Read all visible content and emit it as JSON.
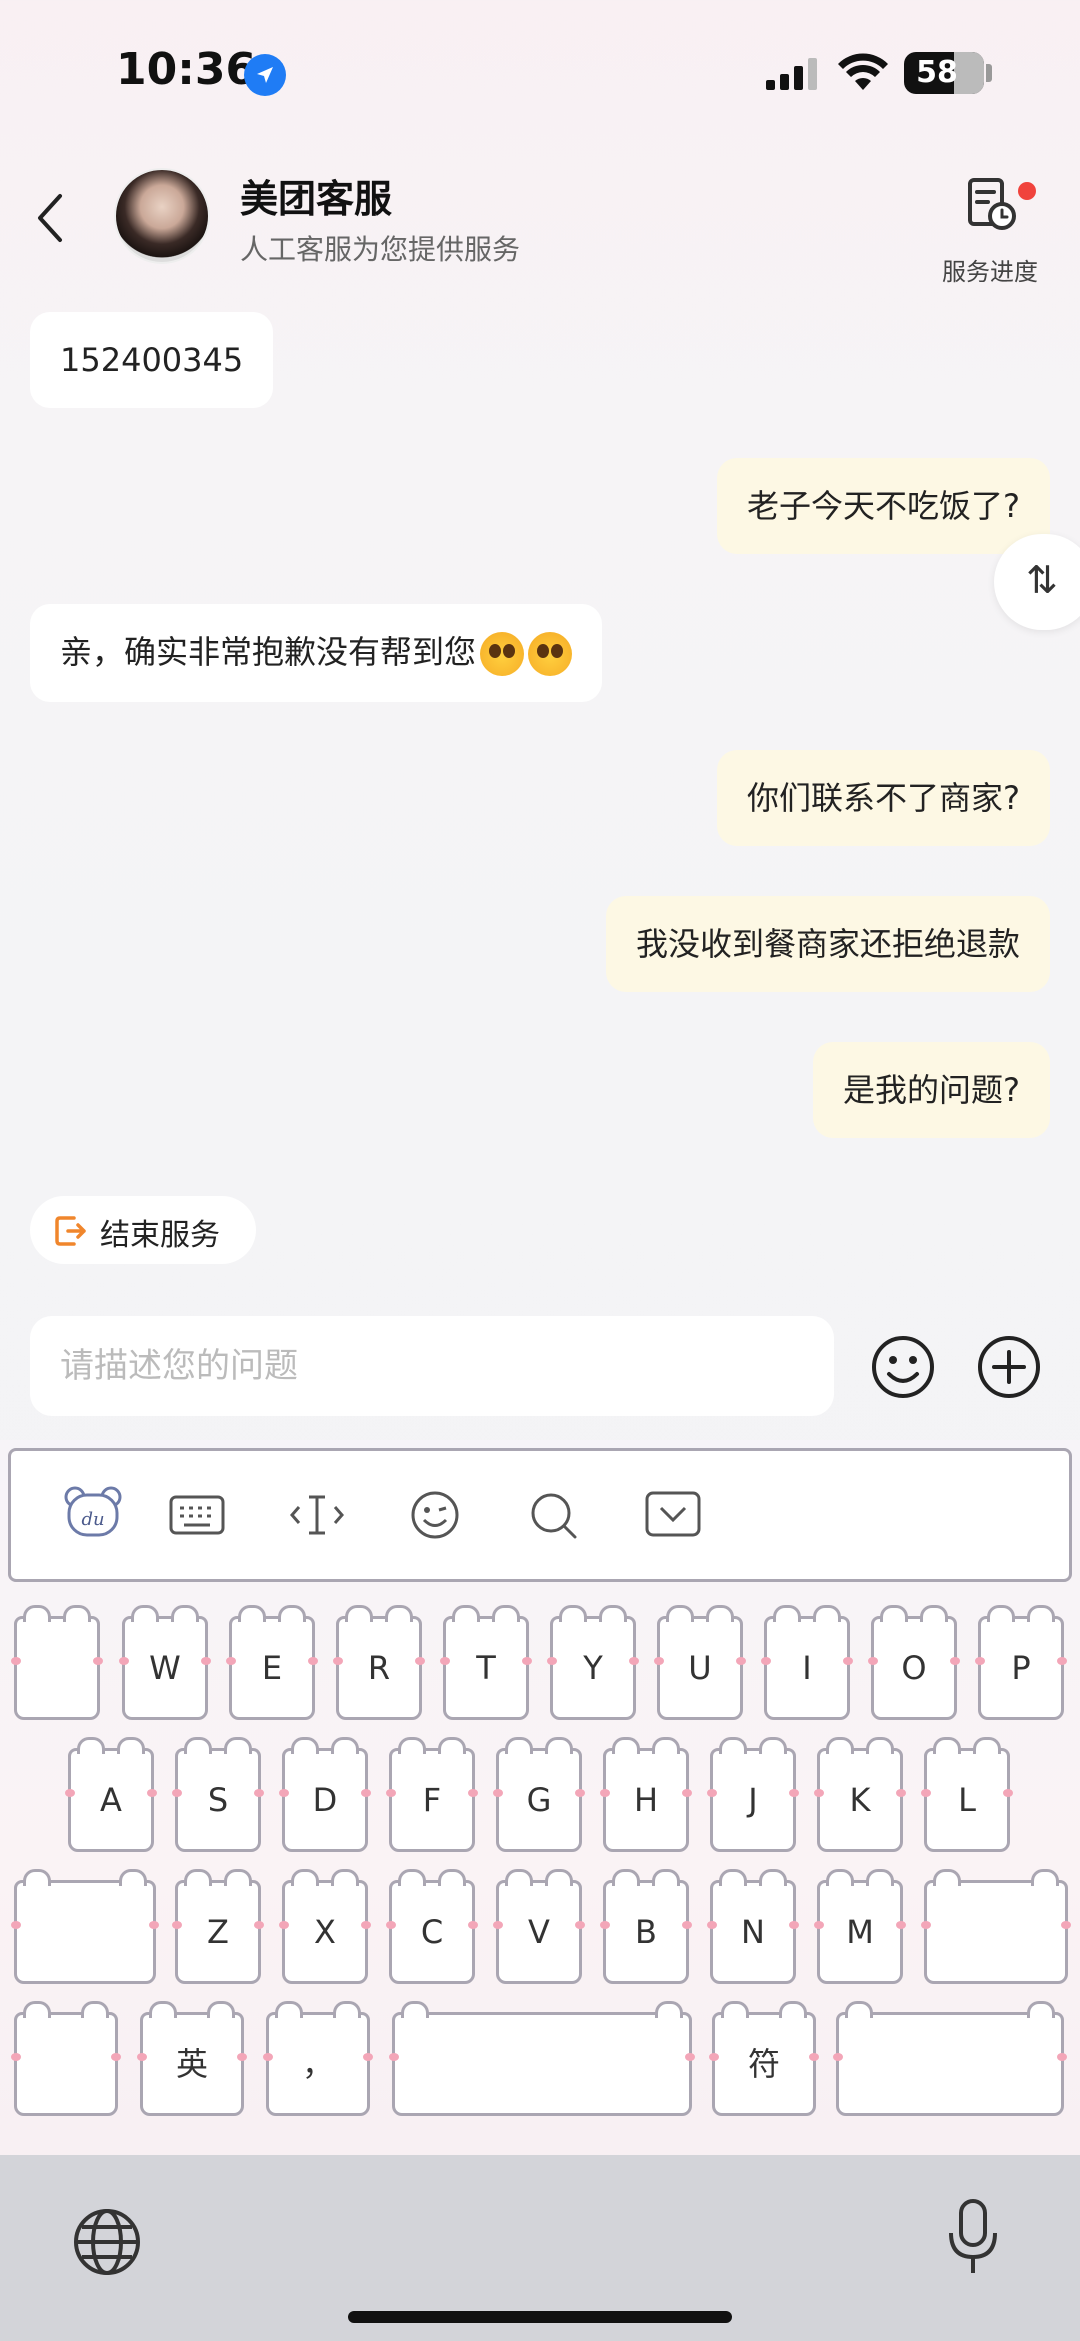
{
  "status_bar": {
    "time": "10:36",
    "battery": "58"
  },
  "header": {
    "title": "美团客服",
    "subtitle": "人工客服为您提供服务",
    "progress_label": "服务进度"
  },
  "messages": [
    {
      "side": "left",
      "text": "152400345"
    },
    {
      "side": "right",
      "text": "老子今天不吃饭了?"
    },
    {
      "side": "left",
      "text": "亲，确实非常抱歉没有帮到您"
    },
    {
      "side": "right",
      "text": "你们联系不了商家?"
    },
    {
      "side": "right",
      "text": "我没收到餐商家还拒绝退款"
    },
    {
      "side": "right",
      "text": "是我的问题?"
    }
  ],
  "sort_button": {
    "label": "⇅"
  },
  "end_service": {
    "label": "结束服务"
  },
  "input": {
    "placeholder": "请描述您的问题",
    "value": ""
  },
  "keyboard": {
    "row1": [
      "",
      "W",
      "E",
      "R",
      "T",
      "Y",
      "U",
      "I",
      "O",
      "P"
    ],
    "row2": [
      "A",
      "S",
      "D",
      "F",
      "G",
      "H",
      "J",
      "K",
      "L"
    ],
    "row3": [
      "Z",
      "X",
      "C",
      "V",
      "B",
      "N",
      "M"
    ],
    "lang_key": "英",
    "comma_key": "，",
    "symbol_key": "符"
  },
  "colors": {
    "accent_orange": "#f0862c",
    "badge_red": "#f0433c",
    "bubble_right": "#fdf8e4"
  }
}
